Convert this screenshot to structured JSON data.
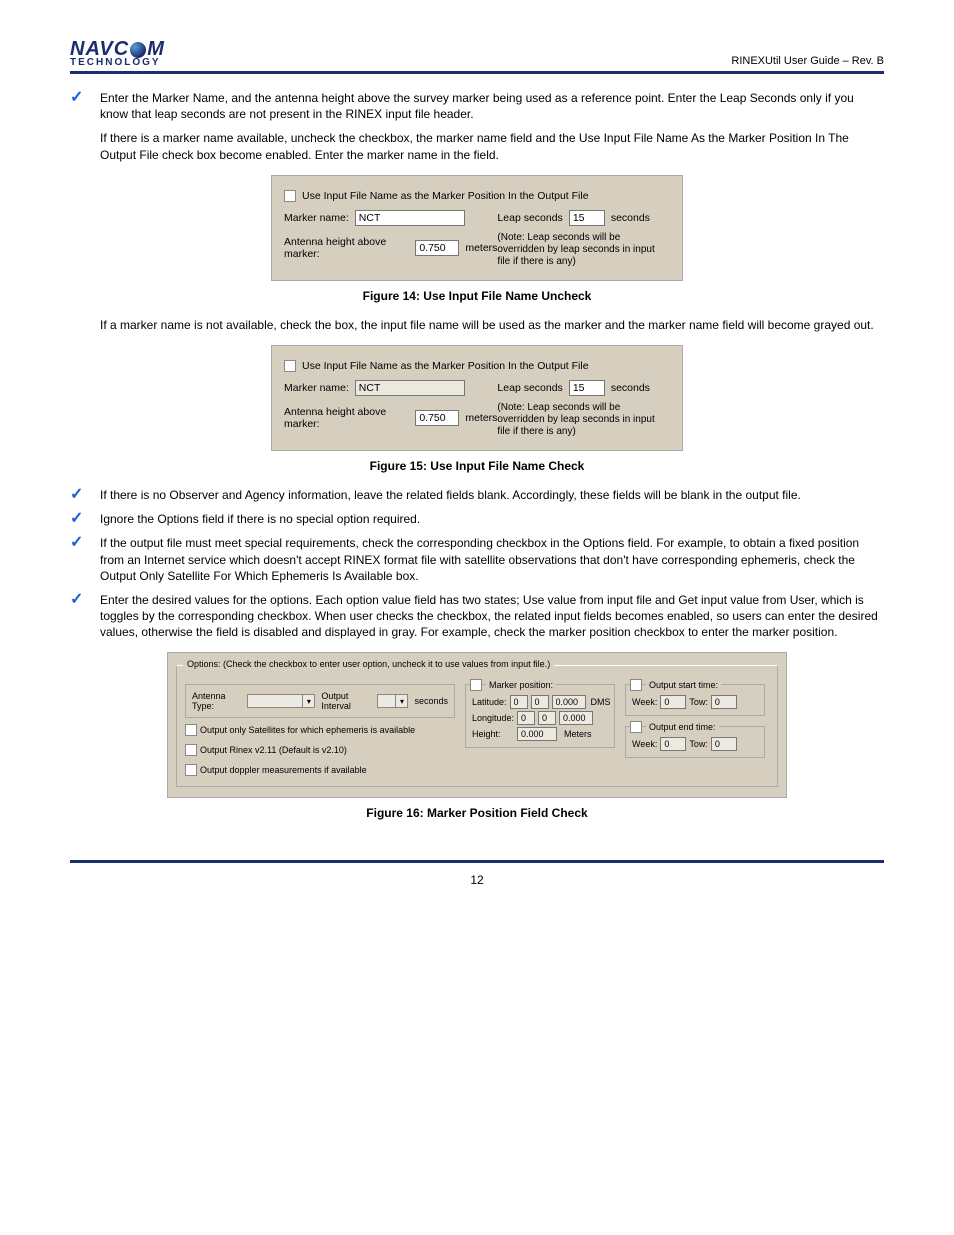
{
  "header": {
    "logo_top_left": "NAVC",
    "logo_top_right": "M",
    "logo_bottom": "TECHNOLOGY",
    "doc_title": "RINEXUtil User Guide – Rev. B"
  },
  "items": [
    {
      "text": "Enter the Marker Name, and the antenna height above the survey marker being used as a reference point. Enter the Leap Seconds only if you know that leap seconds are not present in the RINEX input file header.",
      "after_para": "If there is a marker name available, uncheck the checkbox, the marker name field and the Use Input File Name As the Marker Position In The Output File check box become enabled. Enter the marker name in the field."
    }
  ],
  "panel1": {
    "chk_label": "Use Input File Name as the Marker Position In the Output File",
    "marker_label": "Marker name:",
    "marker_value": "NCT",
    "antenna_label": "Antenna height above marker:",
    "antenna_value": "0.750",
    "meters": "meters",
    "leap_label": "Leap seconds",
    "leap_value": "15",
    "seconds": "seconds",
    "note": "(Note: Leap seconds will be overridden by leap seconds in input file if there is any)"
  },
  "fig14": "Figure 14: Use Input File Name Uncheck",
  "mid_para": "If a marker name is not available, check the box, the input file name will be used as the marker and the marker name field will become grayed out.",
  "fig15": "Figure 15: Use Input File Name Check",
  "check2": "If there is no Observer and Agency information, leave the related fields blank. Accordingly, these fields will be blank in the output file.",
  "check3": "Ignore the Options field if there is no special option required.",
  "check4": "If the output file must meet special requirements, check the corresponding checkbox in the Options field. For example, to obtain a fixed position from an Internet service which doesn't accept RINEX format file with satellite observations that don't have corresponding ephemeris, check the Output Only Satellite For Which Ephemeris Is Available box.",
  "check5": "Enter the desired values for the options. Each option value field has two states; Use value from input file and Get input value from User, which is toggles by the corresponding checkbox. When user checks the checkbox, the related input fields becomes enabled, so users can enter the desired values, otherwise the field is disabled and displayed in gray. For example, check the marker position checkbox to enter the marker position.",
  "options_panel": {
    "legend": "Options: (Check the checkbox to enter user option, uncheck it to use values from input file.)",
    "antenna_type_label": "Antenna Type:",
    "output_interval_label": "Output Interval",
    "seconds": "seconds",
    "opt1": "Output only Satellites for which ephemeris is available",
    "opt2": "Output Rinex v2.11 (Default is v2.10)",
    "opt3": "Output doppler measurements if available",
    "marker_pos": "Marker position:",
    "lat": "Latitude:",
    "lon": "Longitude:",
    "hgt": "Height:",
    "dms": "DMS",
    "meters": "Meters",
    "deg0": "0",
    "min0": "0",
    "sec0": "0.000",
    "h0": "0.000",
    "out_start": "Output start time:",
    "out_end": "Output end time:",
    "week": "Week:",
    "tow": "Tow:",
    "zero": "0"
  },
  "fig16": "Figure 16: Marker Position Field Check",
  "page_no": "12"
}
